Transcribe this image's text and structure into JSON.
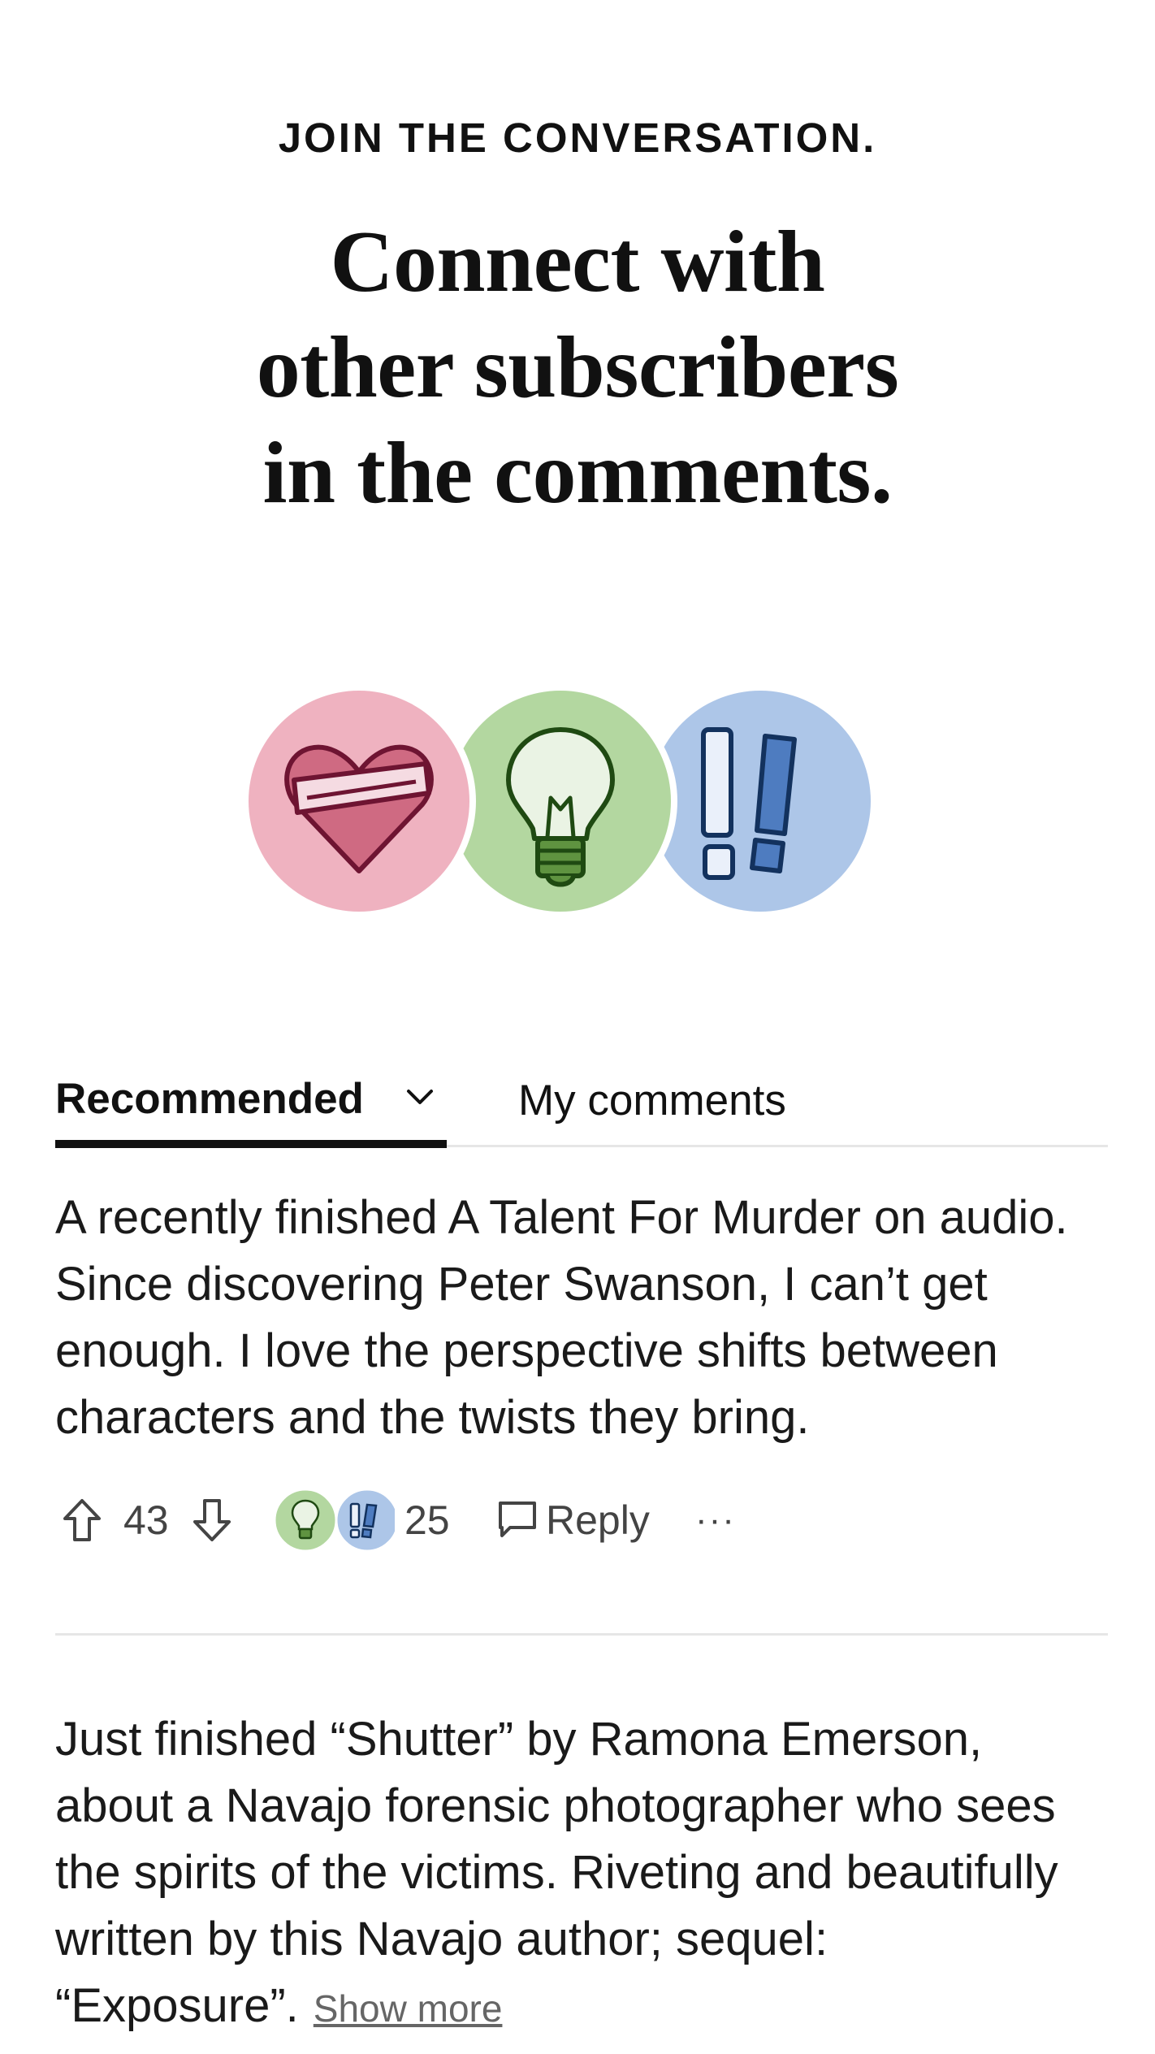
{
  "hero": {
    "eyebrow": "JOIN THE CONVERSATION.",
    "headline_lines": [
      "Connect with",
      "other subscribers",
      "in the comments."
    ]
  },
  "badges": [
    {
      "icon": "bandaged-heart-icon",
      "color": "#efb2c0"
    },
    {
      "icon": "lightbulb-icon",
      "color": "#b3d7a0"
    },
    {
      "icon": "double-exclamation-icon",
      "color": "#adc6e8"
    }
  ],
  "tabs": {
    "recommended": "Recommended",
    "mine": "My comments"
  },
  "comments": [
    {
      "text": "A recently finished A Talent For Murder on audio. Since discovering Peter Swanson, I can’t get enough. I love the perspective shifts between characters and the twists they bring.",
      "upvotes": "43",
      "reactions": "25",
      "reply_label": "Reply",
      "more_label": "···"
    },
    {
      "text": "Just finished “Shutter” by Ramona Emerson, about a Navajo forensic photographer who sees the spirits of the victims. Riveting and beautifully written by this Navajo author; sequel: “Exposure”.",
      "show_more": "Show more"
    }
  ]
}
